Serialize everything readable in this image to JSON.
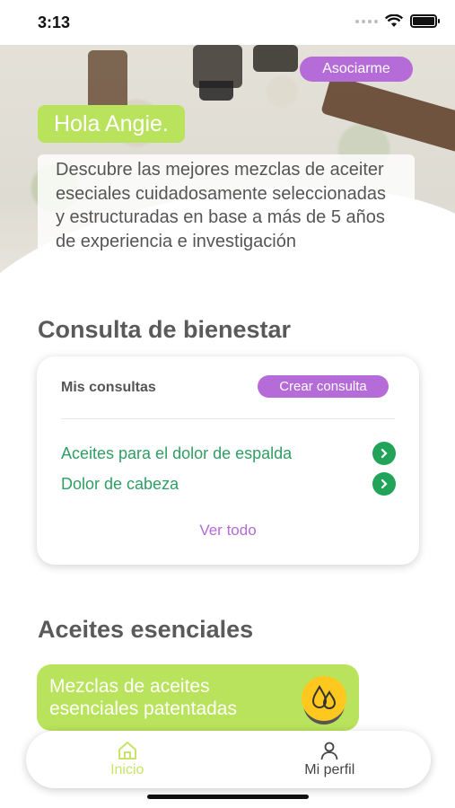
{
  "status_bar": {
    "time": "3:13"
  },
  "hero": {
    "join_label": "Asociarme",
    "greeting": "Hola Angie.",
    "intro_text": "Descubre las mejores mezclas de aceiter eseciales cuidadosamente seleccionadas y estructuradas en base a más de 5 años de experiencia e investigación"
  },
  "wellness": {
    "title": "Consulta de bienestar",
    "card_label": "Mis consultas",
    "create_label": "Crear consulta",
    "items": [
      {
        "label": "Aceites para el dolor de espalda",
        "icon": "chevron-right-icon"
      },
      {
        "label": "Dolor de cabeza",
        "icon": "chevron-right-icon"
      }
    ],
    "see_all_label": "Ver todo"
  },
  "oils": {
    "title": "Aceites esenciales",
    "card_text": "Mezclas de aceites esenciales patentadas",
    "icon": "oil-drops-icon"
  },
  "tab_bar": {
    "tabs": [
      {
        "label": "Inicio",
        "icon": "home-icon",
        "active": true
      },
      {
        "label": "Mi perfil",
        "icon": "user-icon",
        "active": false
      }
    ]
  },
  "colors": {
    "accent_purple": "#b56bd8",
    "accent_green": "#b9e35c",
    "link_green": "#2f9e63",
    "icon_yellow": "#ffc81e"
  }
}
